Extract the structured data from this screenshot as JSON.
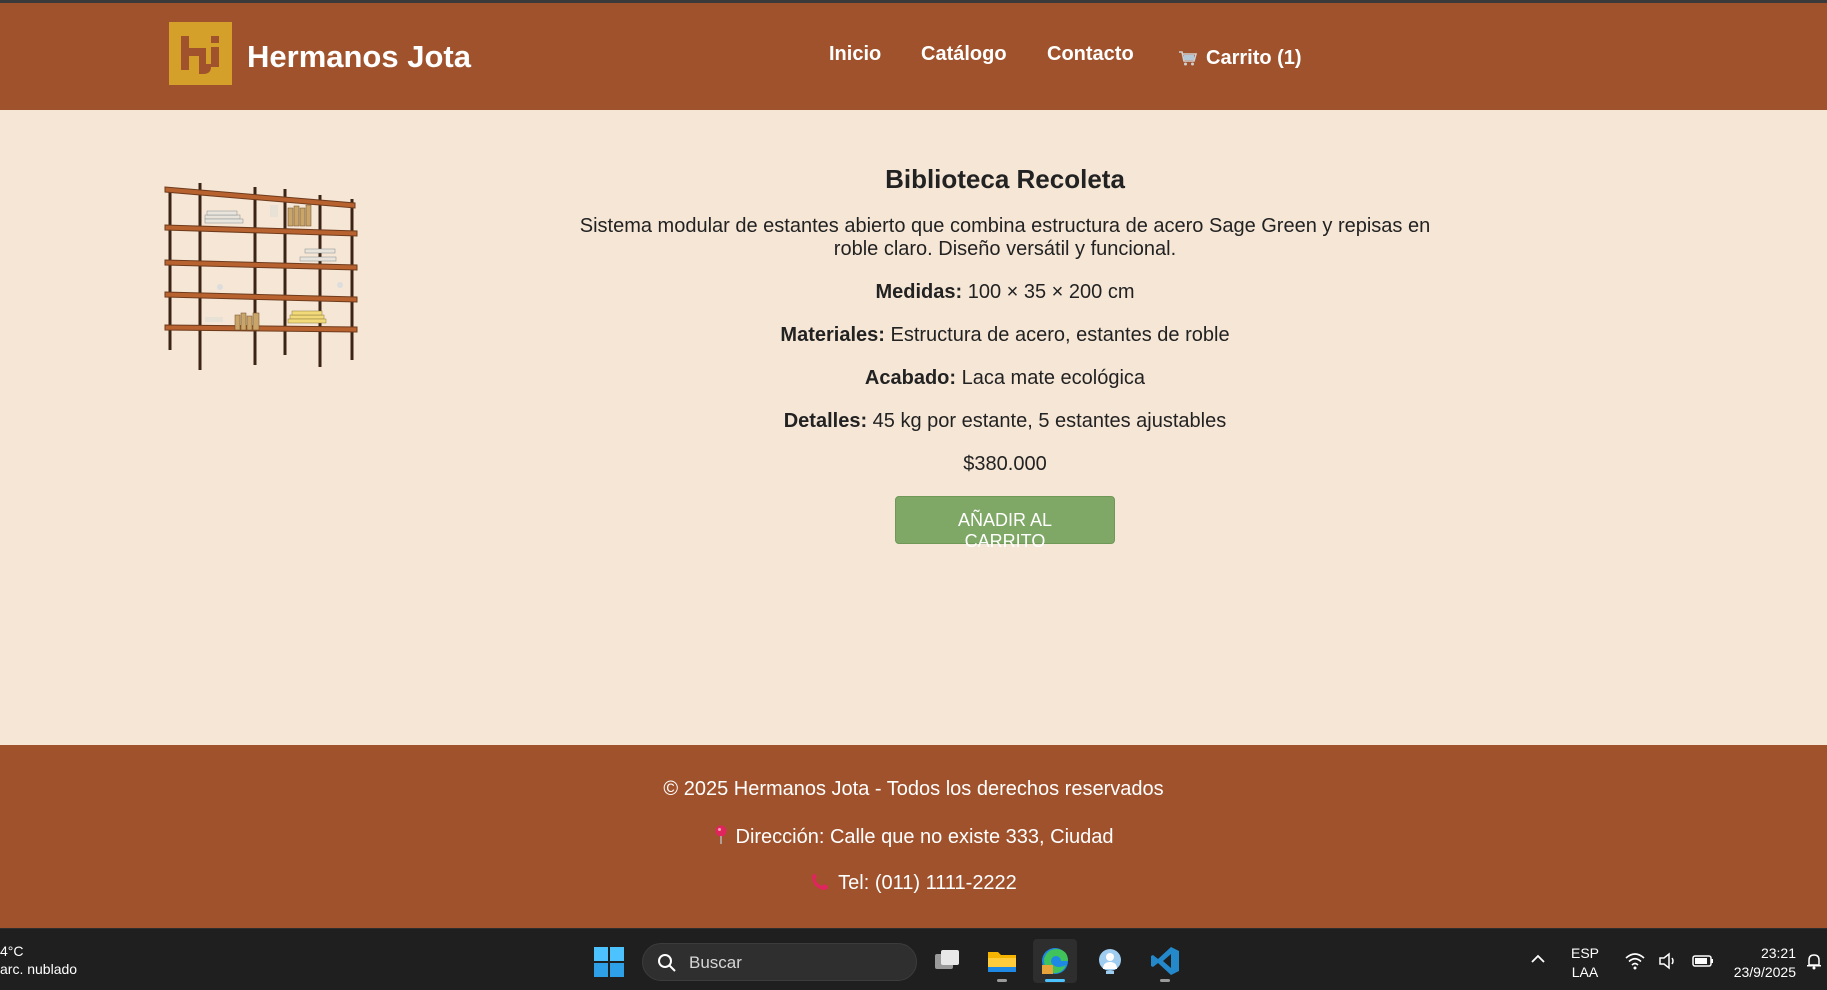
{
  "header": {
    "brand": "Hermanos Jota",
    "nav": {
      "inicio": "Inicio",
      "catalogo": "Catálogo",
      "contacto": "Contacto",
      "carrito": "Carrito (1)"
    },
    "colors": {
      "header_bg": "#a0522d",
      "logo_bg": "#d4a02a"
    }
  },
  "product": {
    "title": "Biblioteca Recoleta",
    "description": "Sistema modular de estantes abierto que combina estructura de acero Sage Green y repisas en roble claro. Diseño versátil y funcional.",
    "specs": [
      {
        "label": "Medidas:",
        "value": "100 × 35 × 200 cm"
      },
      {
        "label": "Materiales:",
        "value": "Estructura de acero, estantes de roble"
      },
      {
        "label": "Acabado:",
        "value": "Laca mate ecológica"
      },
      {
        "label": "Detalles:",
        "value": "45 kg por estante, 5 estantes ajustables"
      }
    ],
    "price": "$380.000",
    "add_button": "AÑADIR AL CARRITO",
    "colors": {
      "button_bg": "#7fa866",
      "page_bg": "#f5e6d6"
    }
  },
  "footer": {
    "copyright": "© 2025 Hermanos Jota - Todos los derechos reservados",
    "address": "Dirección: Calle que no existe 333, Ciudad",
    "phone": "Tel: (011) 1111-2222"
  },
  "taskbar": {
    "weather_temp": "4°C",
    "weather_desc": "arc. nublado",
    "search_placeholder": "Buscar",
    "lang_top": "ESP",
    "lang_bottom": "LAA",
    "time": "23:21",
    "date": "23/9/2025",
    "apps": [
      "task-view-icon",
      "file-explorer-icon",
      "edge-icon",
      "security-icon",
      "vscode-icon"
    ]
  }
}
